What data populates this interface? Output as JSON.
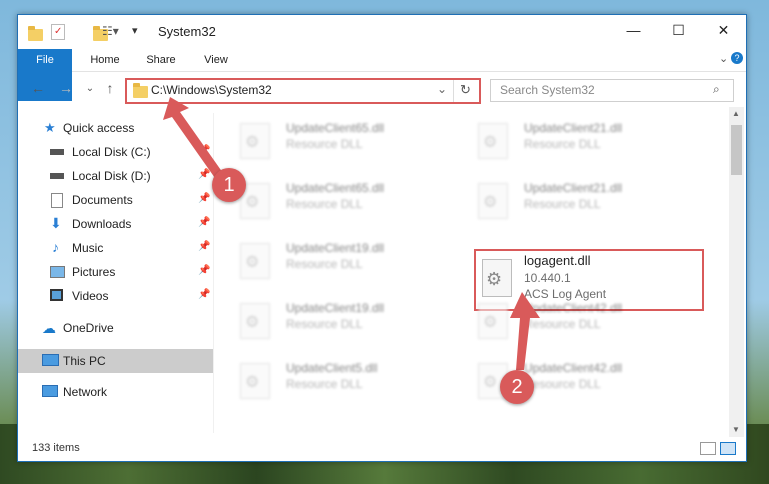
{
  "window": {
    "title": "System32"
  },
  "window_controls": {
    "minimize": "—",
    "maximize": "☐",
    "close": "✕"
  },
  "ribbon": {
    "tabs": [
      "File",
      "Home",
      "Share",
      "View"
    ]
  },
  "address": {
    "path": "C:\\Windows\\System32"
  },
  "search": {
    "placeholder": "Search System32"
  },
  "sidebar": {
    "items": [
      {
        "label": "Quick access",
        "icon": "star-icon",
        "pinned": false
      },
      {
        "label": "Local Disk (C:)",
        "icon": "drive-icon",
        "pinned": true
      },
      {
        "label": "Local Disk (D:)",
        "icon": "drive-icon",
        "pinned": true
      },
      {
        "label": "Documents",
        "icon": "documents-icon",
        "pinned": true
      },
      {
        "label": "Downloads",
        "icon": "downloads-icon",
        "pinned": true
      },
      {
        "label": "Music",
        "icon": "music-icon",
        "pinned": true
      },
      {
        "label": "Pictures",
        "icon": "pictures-icon",
        "pinned": true
      },
      {
        "label": "Videos",
        "icon": "videos-icon",
        "pinned": true
      },
      {
        "label": "OneDrive",
        "icon": "onedrive-icon",
        "pinned": false
      },
      {
        "label": "This PC",
        "icon": "pc-icon",
        "pinned": false,
        "selected": true
      },
      {
        "label": "Network",
        "icon": "network-icon",
        "pinned": false
      }
    ]
  },
  "files": [
    {
      "name": "UpdateClient65.dll",
      "type": "Resource DLL"
    },
    {
      "name": "UpdateClient21.dll",
      "type": "Resource DLL"
    },
    {
      "name": "UpdateClient65.dll",
      "type": "Resource DLL"
    },
    {
      "name": "UpdateClient21.dll",
      "type": "Resource DLL"
    },
    {
      "name": "UpdateClient19.dll",
      "type": "Resource DLL"
    },
    {
      "name": "logagent.dll",
      "version": "10.440.1",
      "description": "ACS Log Agent"
    },
    {
      "name": "UpdateClient19.dll",
      "type": "Resource DLL"
    },
    {
      "name": "UpdateClient42.dll",
      "type": "Resource DLL"
    },
    {
      "name": "UpdateClient5.dll",
      "type": "Resource DLL"
    },
    {
      "name": "UpdateClient42.dll",
      "type": "Resource DLL"
    }
  ],
  "status": {
    "item_count": "133 items"
  },
  "callouts": {
    "one": "1",
    "two": "2"
  },
  "colors": {
    "accent": "#1979ca",
    "highlight": "#d95a5a"
  }
}
